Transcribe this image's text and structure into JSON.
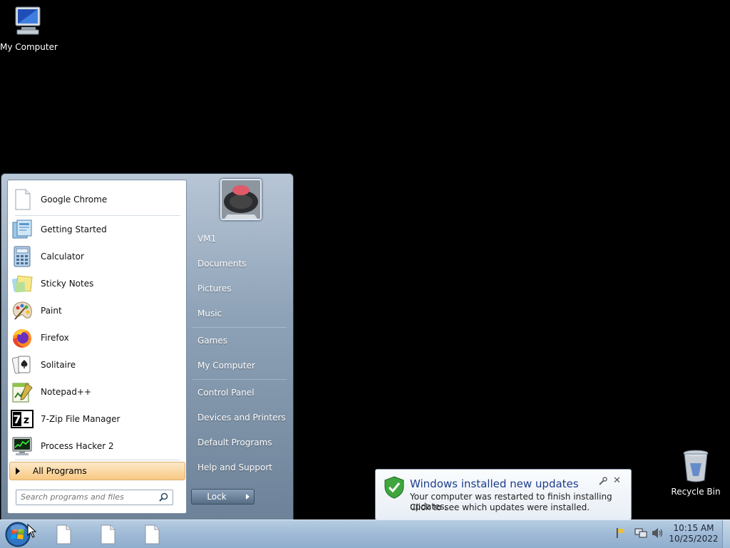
{
  "desktop": {
    "icons": [
      {
        "label": "My Computer",
        "icon": "computer-icon"
      },
      {
        "label": "Recycle Bin",
        "icon": "recycle-bin-icon"
      }
    ]
  },
  "start_menu": {
    "programs": [
      {
        "label": "Google Chrome",
        "icon": "blank-document-icon"
      },
      {
        "label": "Getting Started",
        "icon": "getting-started-icon"
      },
      {
        "label": "Calculator",
        "icon": "calculator-icon"
      },
      {
        "label": "Sticky Notes",
        "icon": "sticky-notes-icon"
      },
      {
        "label": "Paint",
        "icon": "paint-palette-icon"
      },
      {
        "label": "Firefox",
        "icon": "firefox-icon"
      },
      {
        "label": "Solitaire",
        "icon": "solitaire-icon"
      },
      {
        "label": "Notepad++",
        "icon": "notepad-plus-plus-icon"
      },
      {
        "label": "7-Zip File Manager",
        "icon": "7zip-icon"
      },
      {
        "label": "Process Hacker 2",
        "icon": "process-hacker-icon"
      }
    ],
    "all_programs": "All Programs",
    "search_placeholder": "Search programs and files",
    "right_items": [
      "VM1",
      "Documents",
      "Pictures",
      "Music",
      "Games",
      "My Computer",
      "Control Panel",
      "Devices and Printers",
      "Default Programs",
      "Help and Support"
    ],
    "lock_label": "Lock"
  },
  "notification": {
    "title": "Windows installed new updates",
    "line1": "Your computer was restarted to finish installing updates.",
    "line2": "Click to see which updates were installed.",
    "close": "✕"
  },
  "taskbar": {
    "time": "10:15 AM",
    "date": "10/25/2022"
  }
}
